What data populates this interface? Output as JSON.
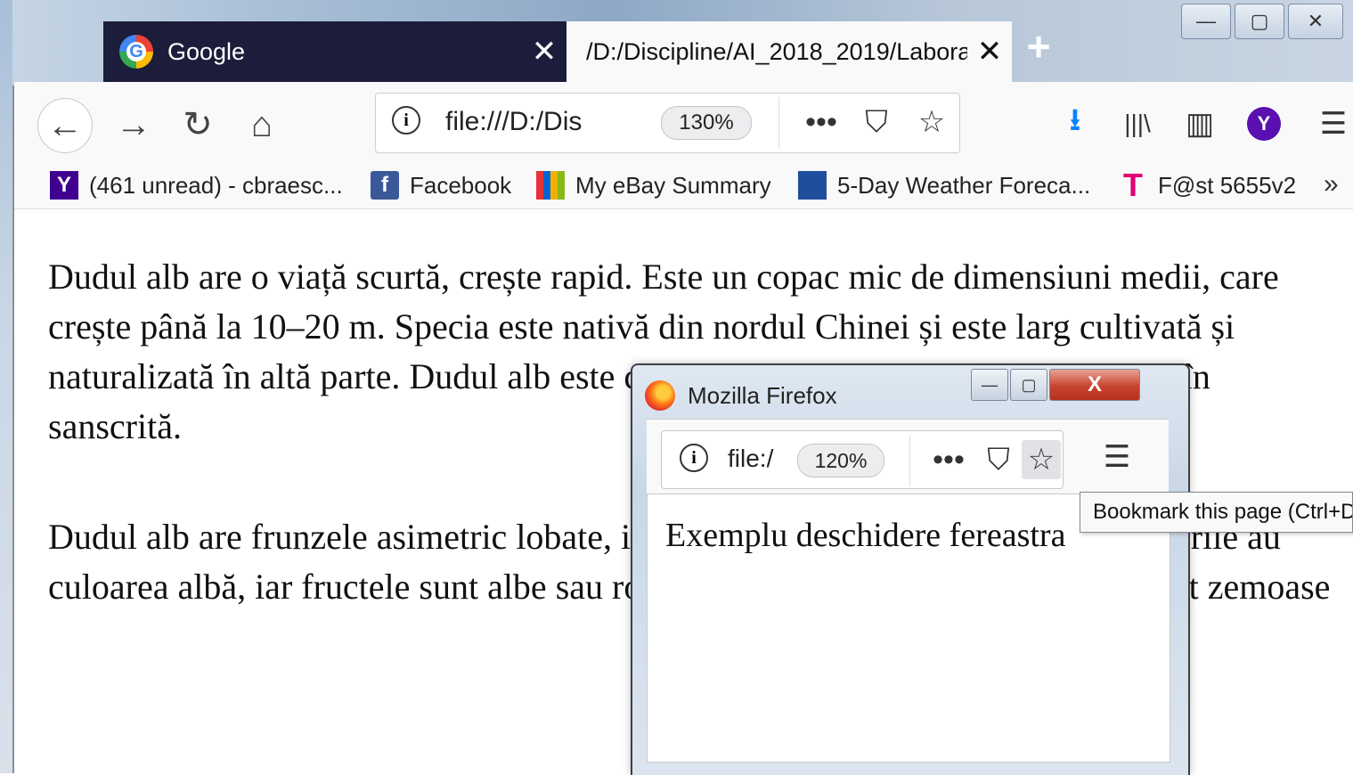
{
  "tabs": [
    {
      "label": "Google",
      "close": "✕"
    },
    {
      "label": "/D:/Discipline/AI_2018_2019/Labora",
      "close": "✕"
    }
  ],
  "new_tab": "+",
  "window_controls": {
    "minimize": "—",
    "maximize": "▢",
    "close": "✕"
  },
  "toolbar": {
    "back": "←",
    "forward": "→",
    "reload": "↻",
    "home": "⌂",
    "url": "file:///D:/Dis",
    "zoom": "130%",
    "page_actions": "•••",
    "pocket": "⛉",
    "star": "☆",
    "download": "⭳",
    "library": "|||\\",
    "sidebar": "▥",
    "avatar": "Y",
    "menu": "☰"
  },
  "bookmarks": [
    {
      "icon": "Y",
      "label": "(461 unread) - cbraesc..."
    },
    {
      "icon": "f",
      "label": "Facebook"
    },
    {
      "icon": "",
      "label": "My eBay Summary"
    },
    {
      "icon": "",
      "label": "5-Day Weather Foreca..."
    },
    {
      "icon": "T",
      "label": "F@st 5655v2"
    }
  ],
  "bookmarks_more": "»",
  "page": {
    "paragraph1": "Dudul alb are o viață scurtă, crește rapid. Este un copac mic de dimensiuni medii, care crește până la 10–20 m. Specia este nativă din nordul Chinei și este larg cultivată și naturalizată în altă parte. Dudul alb este cunoscut ca शहतूत în limba hindi, Tuta în sanscrită.",
    "paragraph2": "Dudul alb are frunzele asimetric lobate, iar coroana arborelui este globulară. Florile au culoarea albă, iar fructele sunt albe sau roz. Fructele se coc în luna august și sunt zemoase"
  },
  "popup": {
    "title": "Mozilla Firefox",
    "url": "file:/",
    "zoom": "120%",
    "page_actions": "•••",
    "pocket": "⛉",
    "star": "☆",
    "menu": "☰",
    "content": "Exemplu deschidere fereastra",
    "controls": {
      "minimize": "—",
      "maximize": "▢",
      "close": "X"
    }
  },
  "tooltip": "Bookmark this page (Ctrl+D)"
}
